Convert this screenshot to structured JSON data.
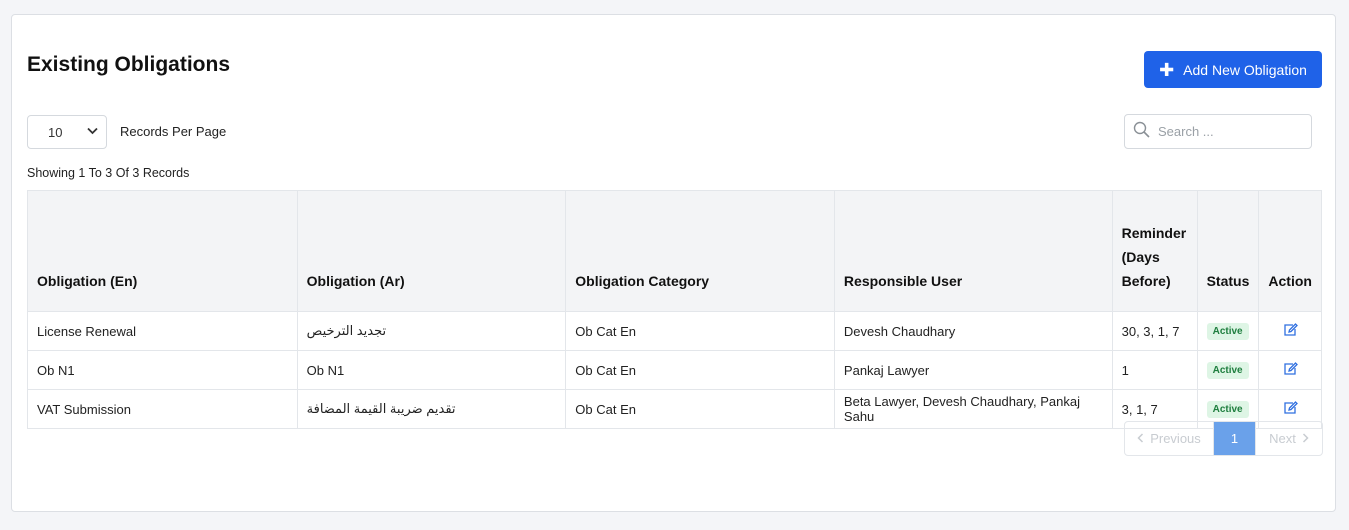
{
  "header": {
    "title": "Existing Obligations",
    "add_button_label": "Add New Obligation"
  },
  "controls": {
    "per_page_value": "10",
    "per_page_label": "Records Per Page",
    "search_placeholder": "Search ..."
  },
  "summary": "Showing 1 To 3 Of 3 Records",
  "table": {
    "headers": [
      "Obligation (En)",
      "Obligation (Ar)",
      "Obligation Category",
      "Responsible User",
      "Reminder (Days Before)",
      "Status",
      "Action"
    ],
    "rows": [
      {
        "en": "License Renewal",
        "ar": "تجديد الترخيص",
        "category": "Ob Cat En",
        "user": "Devesh Chaudhary",
        "reminder": "30, 3, 1, 7",
        "status": "Active",
        "action_icon": "edit-icon"
      },
      {
        "en": "Ob N1",
        "ar": "Ob N1",
        "category": "Ob Cat En",
        "user": "Pankaj Lawyer",
        "reminder": "1",
        "status": "Active",
        "action_icon": "edit-icon"
      },
      {
        "en": "VAT Submission",
        "ar": "تقديم ضريبة القيمة المضافة",
        "category": "Ob Cat En",
        "user": "Beta Lawyer, Devesh Chaudhary, Pankaj Sahu",
        "reminder": "3, 1, 7",
        "status": "Active",
        "action_icon": "edit-icon"
      }
    ]
  },
  "pagination": {
    "prev_label": "Previous",
    "current_page": "1",
    "next_label": "Next"
  },
  "colors": {
    "primary": "#1f62e8",
    "active_page": "#6aa1ea",
    "badge_bg": "#def5e5",
    "badge_text": "#1e7e3e"
  }
}
